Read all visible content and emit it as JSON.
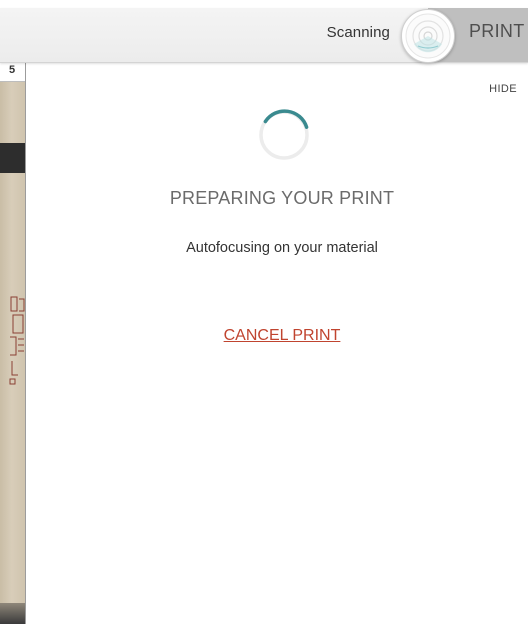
{
  "header": {
    "status_text": "Scanning",
    "tab_label": "PRINT"
  },
  "ruler": {
    "number": "5"
  },
  "panel": {
    "hide_label": "HIDE",
    "title": "PREPARING YOUR PRINT",
    "status": "Autofocusing on your material",
    "cancel_label": "CANCEL PRINT"
  },
  "colors": {
    "spinner_accent": "#3a8a8f",
    "cancel_link": "#c0442f",
    "print_tab": "#bfbfbf"
  },
  "icons": {
    "scan_button": "radar-scan-icon",
    "spinner": "loading-spinner-icon"
  }
}
